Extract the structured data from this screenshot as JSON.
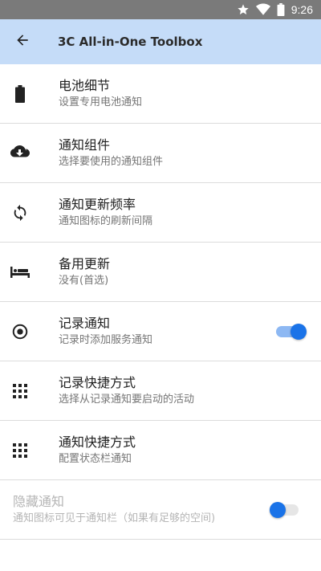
{
  "statusbar": {
    "time": "9:26",
    "icons": [
      "star-icon",
      "wifi-icon",
      "battery-icon"
    ]
  },
  "appbar": {
    "title": "3C All-in-One Toolbox",
    "back_icon": "arrow-left-icon",
    "background": "#c5dcf8"
  },
  "settings": [
    {
      "title": "电池细节",
      "subtitle": "设置专用电池通知",
      "icon": "battery-icon"
    },
    {
      "title": "通知组件",
      "subtitle": "选择要使用的通知组件",
      "icon": "cloud-download-icon"
    },
    {
      "title": "通知更新频率",
      "subtitle": "通知图标的刷新间隔",
      "icon": "sync-icon"
    },
    {
      "title": "备用更新",
      "subtitle": "没有(首选)",
      "icon": "hotel-icon"
    },
    {
      "title": "记录通知",
      "subtitle": "记录时添加服务通知",
      "icon": "radio-button-icon",
      "toggle": true
    },
    {
      "title": "记录快捷方式",
      "subtitle": "选择从记录通知要启动的活动",
      "icon": "grid-icon"
    },
    {
      "title": "通知快捷方式",
      "subtitle": "配置状态栏通知",
      "icon": "grid-icon"
    },
    {
      "title": "隐藏通知",
      "subtitle": "通知图标可见于通知栏（如果有足够的空间)",
      "disabled": true,
      "toggle": true
    }
  ],
  "colors": {
    "accent": "#1a73e8",
    "switch_track_on": "#8db8f3",
    "divider": "#dcdcdc"
  }
}
